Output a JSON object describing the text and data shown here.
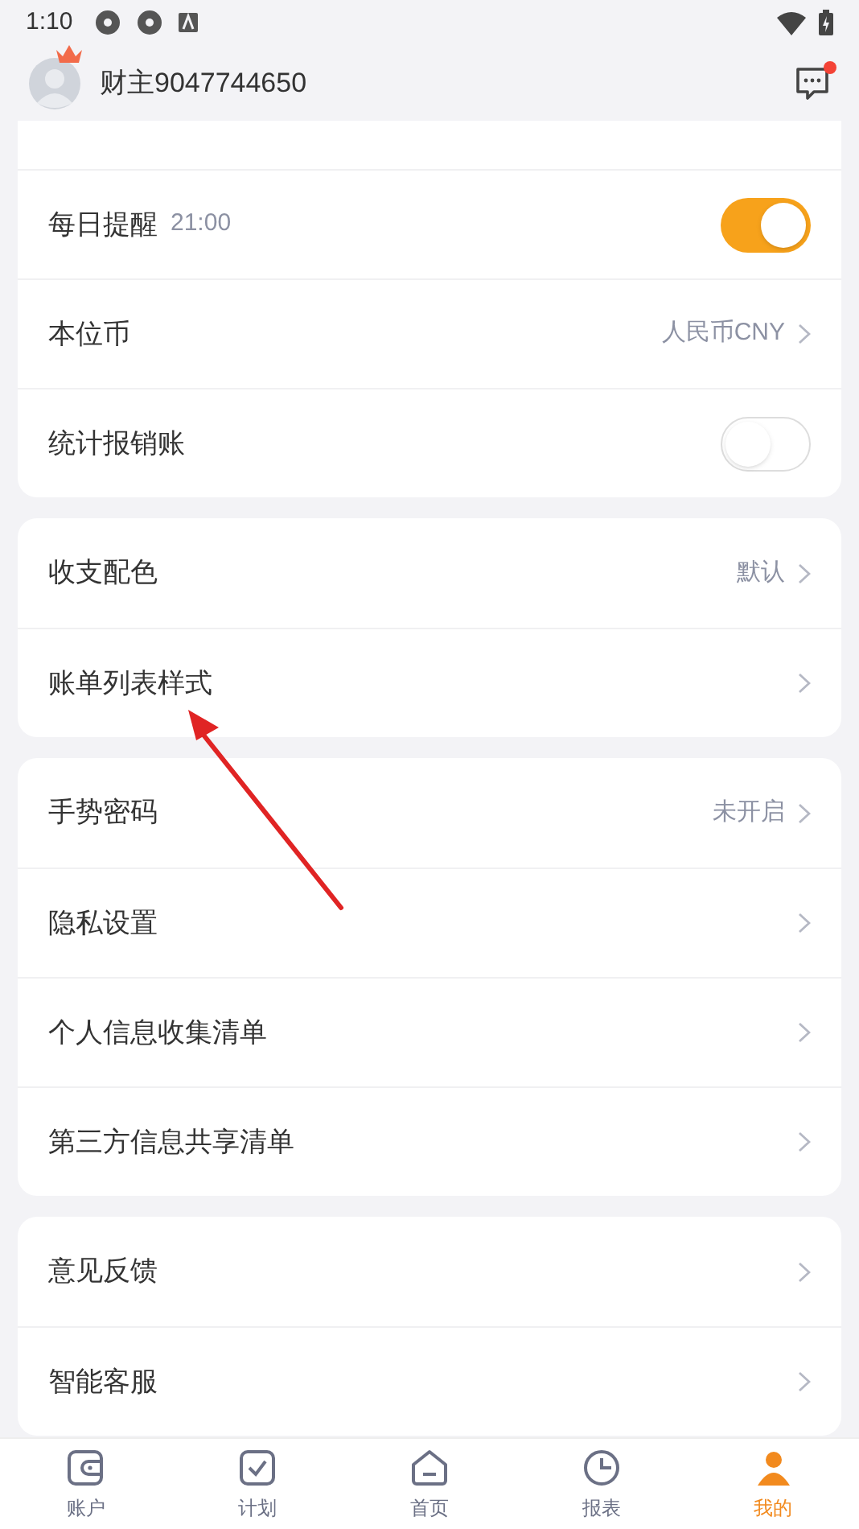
{
  "status_bar": {
    "time": "1:10"
  },
  "header": {
    "username": "财主9047744650",
    "has_notification": true
  },
  "groups": [
    {
      "rows": [
        {
          "kind": "toggle",
          "label": "每日提醒",
          "note": "21:00",
          "on": true
        },
        {
          "kind": "link",
          "label": "本位币",
          "value": "人民币CNY"
        },
        {
          "kind": "toggle",
          "label": "统计报销账",
          "on": false
        }
      ]
    },
    {
      "rows": [
        {
          "kind": "link",
          "label": "收支配色",
          "value": "默认"
        },
        {
          "kind": "link",
          "label": "账单列表样式"
        }
      ]
    },
    {
      "rows": [
        {
          "kind": "link",
          "label": "手势密码",
          "value": "未开启"
        },
        {
          "kind": "link",
          "label": "隐私设置"
        },
        {
          "kind": "link",
          "label": "个人信息收集清单"
        },
        {
          "kind": "link",
          "label": "第三方信息共享清单"
        }
      ]
    },
    {
      "rows": [
        {
          "kind": "link",
          "label": "意见反馈"
        },
        {
          "kind": "link",
          "label": "智能客服"
        }
      ]
    }
  ],
  "bottom_nav": [
    {
      "label": "账户",
      "selected": false
    },
    {
      "label": "计划",
      "selected": false
    },
    {
      "label": "首页",
      "selected": false
    },
    {
      "label": "报表",
      "selected": false
    },
    {
      "label": "我的",
      "selected": true
    }
  ]
}
